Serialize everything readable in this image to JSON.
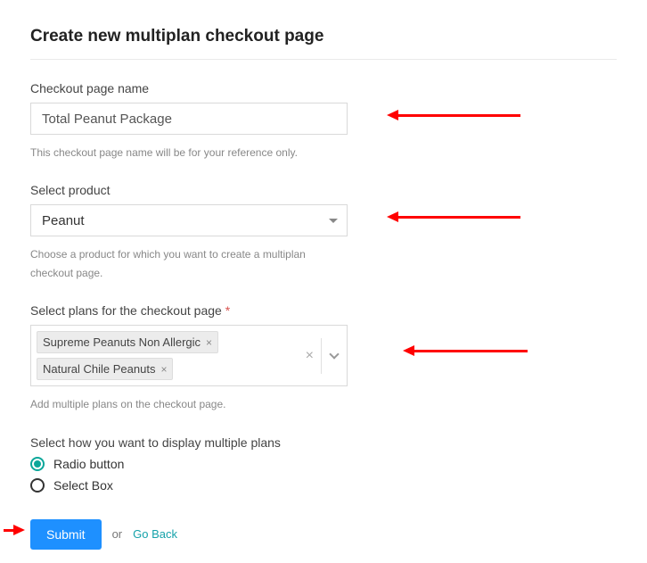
{
  "header": {
    "title": "Create new multiplan checkout page"
  },
  "fields": {
    "name": {
      "label": "Checkout page name",
      "value": "Total Peanut Package",
      "help": "This checkout page name will be for your reference only."
    },
    "product": {
      "label": "Select product",
      "value": "Peanut",
      "help": "Choose a product for which you want to create a multiplan checkout page."
    },
    "plans": {
      "label": "Select plans for the checkout page",
      "required_marker": "*",
      "chips": [
        "Supreme Peanuts Non Allergic",
        "Natural Chile Peanuts"
      ],
      "help": "Add multiple plans on the checkout page."
    },
    "display": {
      "label": "Select how you want to display multiple plans",
      "options": [
        "Radio button",
        "Select Box"
      ],
      "selected": "Radio button"
    }
  },
  "actions": {
    "submit": "Submit",
    "or": "or",
    "go_back": "Go Back"
  }
}
